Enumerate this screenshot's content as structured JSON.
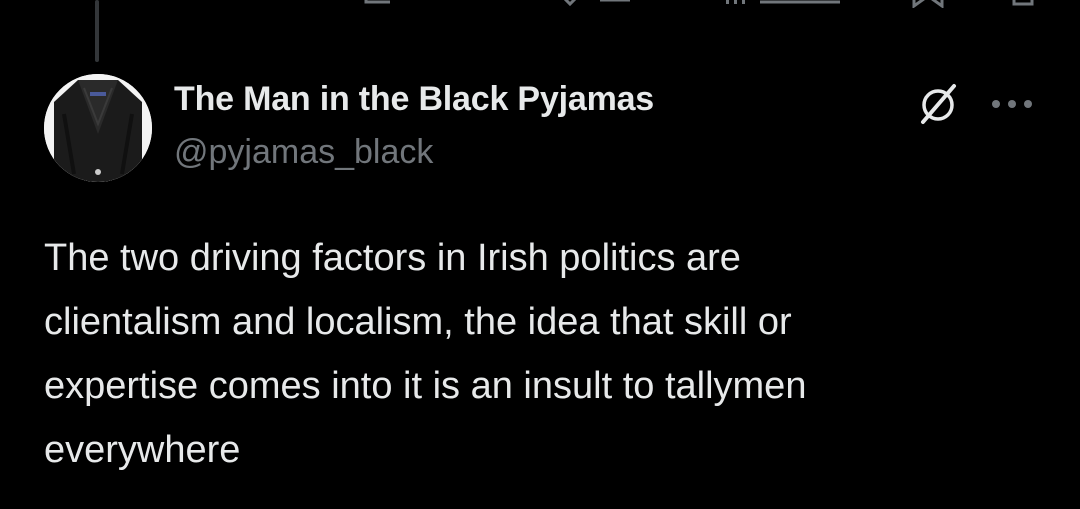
{
  "thread": {
    "connector": "thread-line"
  },
  "previous_tweet_actions": {
    "icons": [
      "reply-icon",
      "retweet-icon",
      "like-icon",
      "views-icon",
      "bookmark-icon",
      "share-icon"
    ]
  },
  "tweet": {
    "author_name": "The Man in the Black Pyjamas",
    "author_handle": "@pyjamas_black",
    "text": "The two driving factors in Irish politics are\nclientalism and localism, the idea that skill or\nexpertise comes into it is an insult to tallymen\neverywhere",
    "icons": {
      "grok": "grok-icon",
      "more": "more-icon"
    }
  },
  "colors": {
    "background": "#000000",
    "primary_text": "#e7e9ea",
    "secondary_text": "#71767b",
    "thread_line": "#333639"
  }
}
